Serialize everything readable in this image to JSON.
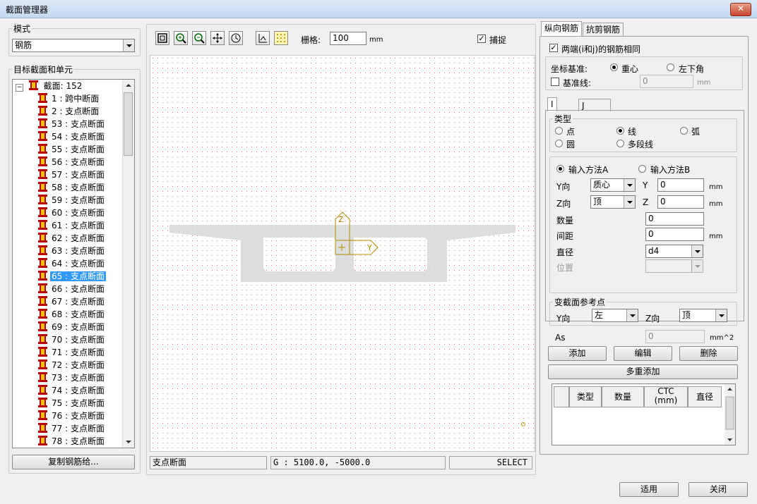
{
  "window": {
    "title": "截面管理器",
    "close_glyph": "✕"
  },
  "mode": {
    "label": "模式",
    "value": "钢筋"
  },
  "target": {
    "label": "目标截面和单元",
    "root": "截面: 152",
    "items": [
      "1 : 跨中断面",
      "2 : 支点断面",
      "53 : 支点断面",
      "54 : 支点断面",
      "55 : 支点断面",
      "56 : 支点断面",
      "57 : 支点断面",
      "58 : 支点断面",
      "59 : 支点断面",
      "60 : 支点断面",
      "61 : 支点断面",
      "62 : 支点断面",
      "63 : 支点断面",
      "64 : 支点断面",
      "65 : 支点断面",
      "66 : 支点断面",
      "67 : 支点断面",
      "68 : 支点断面",
      "69 : 支点断面",
      "70 : 支点断面",
      "71 : 支点断面",
      "72 : 支点断面",
      "73 : 支点断面",
      "74 : 支点断面",
      "75 : 支点断面",
      "76 : 支点断面",
      "77 : 支点断面",
      "78 : 支点断面"
    ],
    "selected_index": 14,
    "copy_button": "复制钢筋给..."
  },
  "toolbar": {
    "grid_label": "栅格:",
    "grid_value": "100",
    "grid_unit": "mm",
    "snap_label": "捕捉",
    "snap_checked": true
  },
  "canvas": {
    "axis_z": "Z",
    "axis_y": "Y"
  },
  "statusbar": {
    "name": "支点断面",
    "coord": "G : 5100.0, -5000.0",
    "mode": "SELECT"
  },
  "tabs": {
    "longitudinal": "纵向钢筋",
    "shear": "抗剪钢筋"
  },
  "rebar": {
    "same_ends": "两端(i和j)的钢筋相同",
    "coord_basis_label": "坐标基准:",
    "centroid": "重心",
    "bottom_left": "左下角",
    "baseline": "基准线:",
    "baseline_value": "0",
    "mm": "mm",
    "end_tabs": [
      "I",
      "J"
    ],
    "type_label": "类型",
    "types": {
      "point": "点",
      "line": "线",
      "arc": "弧",
      "circle": "圆",
      "polyline": "多段线"
    },
    "input_a": "输入方法A",
    "input_b": "输入方法B",
    "y_dir": "Y向",
    "y_dir_value": "质心",
    "y_label": "Y",
    "y_value": "0",
    "z_dir": "Z向",
    "z_dir_value": "顶",
    "z_label": "Z",
    "z_value": "0",
    "count_label": "数量",
    "count_value": "0",
    "spacing_label": "间距",
    "spacing_value": "0",
    "diameter_label": "直径",
    "diameter_value": "d4",
    "position_label": "位置",
    "varsec_label": "变截面参考点",
    "vs_y_dir": "Y向",
    "vs_y_value": "左",
    "vs_z_dir": "Z向",
    "vs_z_value": "顶",
    "as_label": "As",
    "as_value": "0",
    "as_unit": "mm^2",
    "add": "添加",
    "edit": "编辑",
    "delete": "删除",
    "multi_add": "多重添加",
    "table_headers": [
      "类型",
      "数量",
      "CTC\n(mm)",
      "直径"
    ]
  },
  "footer": {
    "apply": "适用",
    "close": "关闭"
  }
}
